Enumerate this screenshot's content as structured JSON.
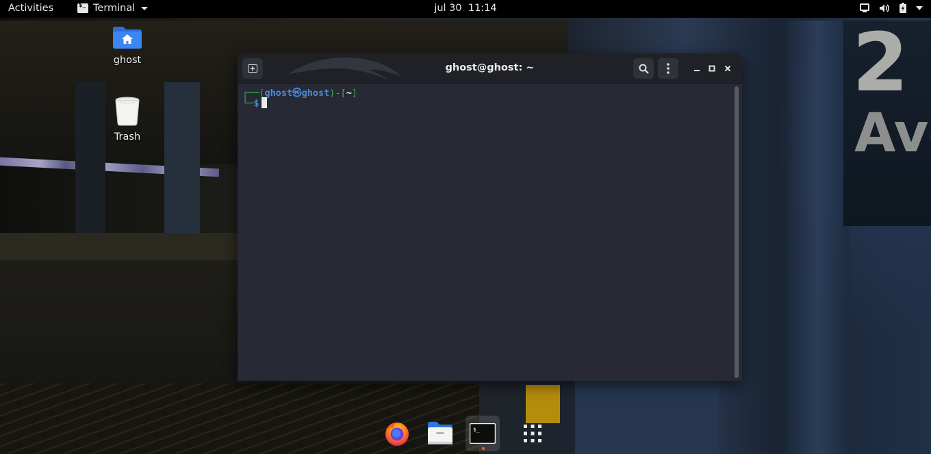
{
  "topbar": {
    "activities": "Activities",
    "app_name": "Terminal",
    "clock_date": "jul 30",
    "clock_time": "11:14"
  },
  "desktop": {
    "icons": [
      {
        "label": "ghost",
        "icon": "home-folder-icon"
      },
      {
        "label": "Trash",
        "icon": "trash-icon"
      }
    ]
  },
  "terminal": {
    "title": "ghost@ghost: ~",
    "prompt": {
      "open_bracket": "┌──(",
      "user": "ghost",
      "at_symbol": "㉿",
      "host": "ghost",
      "mid": ")-[",
      "dir": "~",
      "close_bracket": "]",
      "line2_prefix": "└─",
      "dollar": "$"
    }
  },
  "dock": {
    "items": [
      "firefox-icon",
      "files-icon",
      "terminal-icon",
      "show-apps-icon"
    ]
  },
  "colors": {
    "prompt_green": "#2fb24b",
    "prompt_blue": "#4b8ad6",
    "terminal_bg": "#272a34",
    "titlebar_bg": "#1f2127",
    "topbar_bg": "#000000"
  }
}
